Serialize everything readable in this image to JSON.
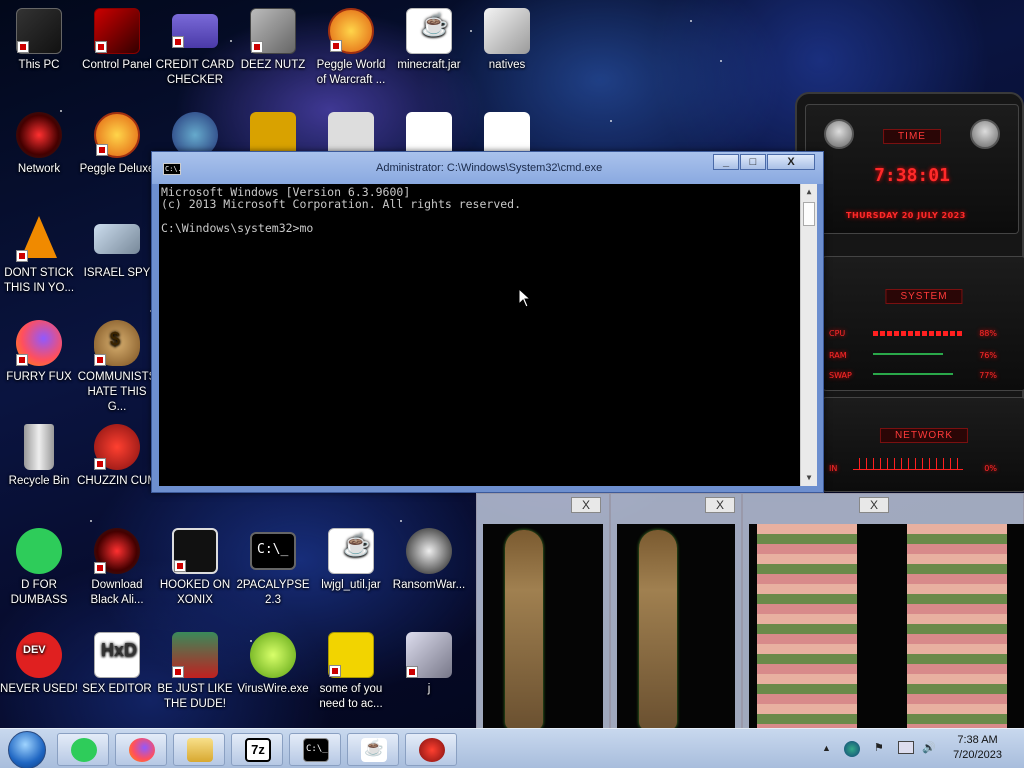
{
  "desktop": {
    "icons": [
      {
        "label": "This PC"
      },
      {
        "label": "Control Panel"
      },
      {
        "label": "CREDIT CARD CHECKER"
      },
      {
        "label": "DEEZ NUTZ"
      },
      {
        "label": "Peggle World of Warcraft ..."
      },
      {
        "label": "minecraft.jar"
      },
      {
        "label": "natives"
      },
      {
        "label": "Network"
      },
      {
        "label": "Peggle Deluxe"
      },
      {
        "label": "DONT STICK THIS IN YO..."
      },
      {
        "label": "ISRAEL SPY"
      },
      {
        "label": "FURRY FUX"
      },
      {
        "label": "COMMUNISTS HATE THIS G..."
      },
      {
        "label": "Recycle Bin"
      },
      {
        "label": "CHUZZIN CUM"
      },
      {
        "label": "D FOR DUMBASS"
      },
      {
        "label": "Download Black Ali..."
      },
      {
        "label": "HOOKED ON XONIX"
      },
      {
        "label": "2PACALYPSE 2.3"
      },
      {
        "label": "lwjgl_util.jar"
      },
      {
        "label": "RansomWar..."
      },
      {
        "label": "NEVER USED!"
      },
      {
        "label": "SEX EDITOR"
      },
      {
        "label": "BE JUST LIKE THE DUDE!"
      },
      {
        "label": "VirusWire.exe"
      },
      {
        "label": "some of you need to ac..."
      },
      {
        "label": "j"
      }
    ]
  },
  "cmd": {
    "title": "Administrator: C:\\Windows\\System32\\cmd.exe",
    "sys_icon": "C:\\.",
    "min": "_",
    "max": "□",
    "close": "X",
    "lines": [
      "Microsoft Windows [Version 6.3.9600]",
      "(c) 2013 Microsoft Corporation. All rights reserved.",
      "",
      "C:\\Windows\\system32>mo"
    ]
  },
  "gadget": {
    "time_title": "TIME",
    "time": "7:38:01",
    "date": "THURSDAY 20 JULY 2023",
    "system_title": "SYSTEM",
    "cpu_label": "CPU",
    "cpu_value": "88%",
    "ram_label": "RAM",
    "ram_value": "76%",
    "swap_label": "SWAP",
    "swap_value": "77%",
    "network_title": "NETWORK",
    "net_in_label": "IN",
    "net_in_value": "0%"
  },
  "previews": [
    {
      "close": "X"
    },
    {
      "close": "X"
    },
    {
      "close": "X"
    }
  ],
  "taskbar": {
    "time": "7:38 AM",
    "date": "7/20/2023",
    "show_hidden": "▲",
    "apps": [
      "Sticky Notes",
      "Firefox",
      "File Explorer",
      "7-Zip",
      "Command Prompt",
      "Java",
      "Chuzzle"
    ]
  }
}
